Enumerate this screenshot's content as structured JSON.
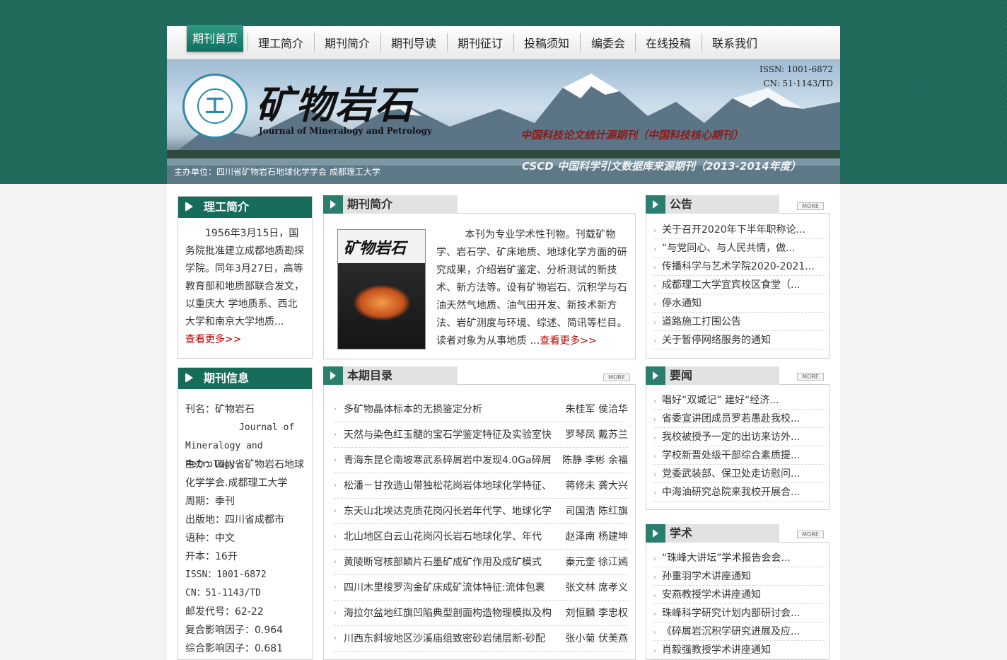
{
  "nav": {
    "home": "期刊首页",
    "items": [
      "理工简介",
      "期刊简介",
      "期刊导读",
      "期刊征订",
      "投稿须知",
      "编委会",
      "在线投稿",
      "联系我们"
    ]
  },
  "banner": {
    "issn": "ISSN: 1001-6872",
    "cn": "CN: 51-1143/TD",
    "logo_char": "工",
    "journal_cn": "矿物岩石",
    "journal_en": "Journal of Mineralogy and Petrology",
    "slogan1": "中国科技论文统计源期刊（中国科技核心期刊）",
    "slogan2": "CSCD 中国科学引文数据库来源期刊（2013-2014年度）",
    "sponsor": "主办单位：四川省矿物岩石地球化学学会 成都理工大学"
  },
  "ligong": {
    "title": "理工简介",
    "text": "1956年3月15日，国务院批准建立成都地质勘探学院。同年3月27日，高等教育部和地质部联合发文，以重庆大 学地质系、西北大学和南京大学地质...",
    "more": "查看更多>>"
  },
  "qikan_info": {
    "title": "期刊信息",
    "lines": [
      "刊名：矿物岩石",
      "Journal of Mineralogy and Petrology",
      "主办：四川省矿物岩石地球化学学会.成都理工大学",
      "周期：季刊",
      "出版地：四川省成都市",
      "语种：中文",
      "开本：16开",
      "ISSN：1001-6872",
      "CN：51-1143/TD",
      "邮发代号：62-22",
      "复合影响因子：0.964",
      "综合影响因子：0.681"
    ]
  },
  "intro": {
    "title": "期刊简介",
    "cover_title": "矿物岩石",
    "text": "本刊为专业学术性刊物。刊载矿物学、岩石学、矿床地质、地球化学方面的研究成果，介绍岩矿鉴定、分析测试的新技术、新方法等。设有矿物岩石、沉积学与石油天然气地质、油气田开发、新技术新方法、岩矿测度与环境、综述、简讯等栏目。读者对象为从事地质 ...",
    "more": "查看更多>>"
  },
  "toc": {
    "title": "本期目录",
    "more": "MORE",
    "items": [
      {
        "title": "多矿物晶体标本的无损鉴定分析",
        "authors": "朱桂军  侯洽华"
      },
      {
        "title": "天然与染色红玉髓的宝石学鉴定特征及实验室快",
        "authors": "罗琴凤  戴苏兰"
      },
      {
        "title": "青海东昆仑南坡寒武系碎屑岩中发现4.0Ga碎屑",
        "authors": "陈静  李彬  余福"
      },
      {
        "title": "松潘－甘孜造山带独松花岗岩体地球化学特征、",
        "authors": "蒋修未  龚大兴"
      },
      {
        "title": "东天山北埃达克质花岗闪长岩年代学、地球化学",
        "authors": "司国浩  陈红旗"
      },
      {
        "title": "北山地区白云山花岗闪长岩石地球化学、年代",
        "authors": "赵泽南  杨建坤"
      },
      {
        "title": "黄陵断穹核部鳞片石墨矿成矿作用及成矿模式",
        "authors": "秦元奎  徐江嫣"
      },
      {
        "title": "四川木里梭罗沟金矿床成矿流体特征:流体包裹",
        "authors": "张文林  席孝义"
      },
      {
        "title": "海拉尔盆地红旗凹陷典型剖面构造物理模拟及构",
        "authors": "刘恒麟  李忠权"
      },
      {
        "title": "川西东斜坡地区沙溪庙组致密砂岩储层断-砂配",
        "authors": "张小菊  伏美燕"
      }
    ]
  },
  "notice": {
    "title": "公告",
    "more": "MORE",
    "items": [
      "关于召开2020年下半年职称论...",
      "“与党同心、与人民共情，做...",
      "传播科学与艺术学院2020-2021...",
      "成都理工大学宜宾校区食堂（...",
      "停水通知",
      "道路施工打围公告",
      "关于暂停网络服务的通知"
    ]
  },
  "news": {
    "title": "要闻",
    "more": "MORE",
    "items": [
      "唱好“双城记” 建好“经济...",
      "省委宣讲团成员罗若愚赴我校...",
      "我校被授予一定的出访来访外...",
      "学校新晋处级干部综合素质提...",
      "党委武装部、保卫处走访慰问...",
      "中海油研究总院来我校开展合..."
    ]
  },
  "academic": {
    "title": "学术",
    "more": "MORE",
    "items": [
      "“珠峰大讲坛”学术报告会会...",
      "孙重羽学术讲座通知",
      "安燕教授学术讲座通知",
      "珠峰科学研究计划内部研讨会...",
      "《碎屑岩沉积学研究进展及应...",
      "肖毅强教授学术讲座通知"
    ]
  },
  "colors": {
    "green_dark": "#176b5b",
    "top_band": "#1d6a5c",
    "link_red": "#c00000"
  }
}
